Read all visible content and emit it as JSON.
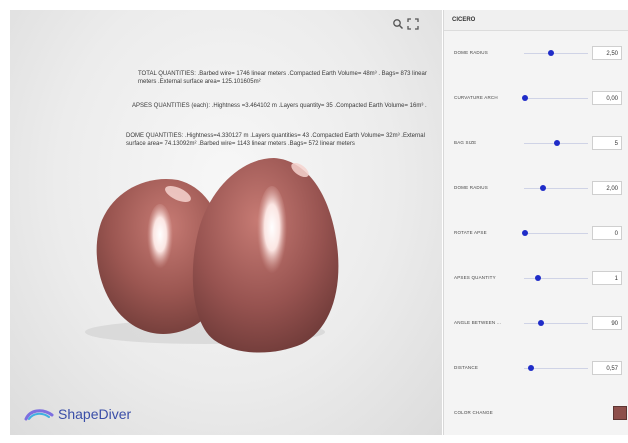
{
  "viewer": {
    "total_quantities": "TOTAL QUANTITIES: .Barbed wire= 1746 linear meters .Compacted Earth Volume= 48m³ . Bags= 873 linear meters .External surface area= 125.101605m²",
    "apses_quantities": "APSES QUANTITIES (each): .Hightness =3.464102 m .Layers quantity= 35 .Compacted Earth Volume= 16m³ .",
    "dome_quantities": "DOME QUANTITIES: .Hightness=4.330127 m .Layers quantities= 43 .Compacted Earth Volume= 32m³ .External surface area= 74.13092m² .Barbed wire= 1143 linear meters .Bags= 572 linear meters",
    "logo_text": "ShapeDiver",
    "model_color": "#8e4f4b"
  },
  "panel": {
    "title": "CICERO",
    "params": [
      {
        "label": "DOME RADIUS",
        "value": "2,50",
        "level": 0.42
      },
      {
        "label": "CURVATURE ARCH",
        "value": "0,00",
        "level": 0.0
      },
      {
        "label": "BAG SIZE",
        "value": "5",
        "level": 0.5
      },
      {
        "label": "DOME RADIUS",
        "value": "2,00",
        "level": 0.3
      },
      {
        "label": "ROTATE APSE",
        "value": "0",
        "level": 0.0
      },
      {
        "label": "APSES QUANTITY",
        "value": "1",
        "level": 0.2
      },
      {
        "label": "ANGLE BETWEEN ...",
        "value": "90",
        "level": 0.25
      },
      {
        "label": "DISTANCE",
        "value": "0,57",
        "level": 0.1
      }
    ],
    "color_change_label": "COLOR CHANGE",
    "color_value": "#8e4f4b"
  }
}
